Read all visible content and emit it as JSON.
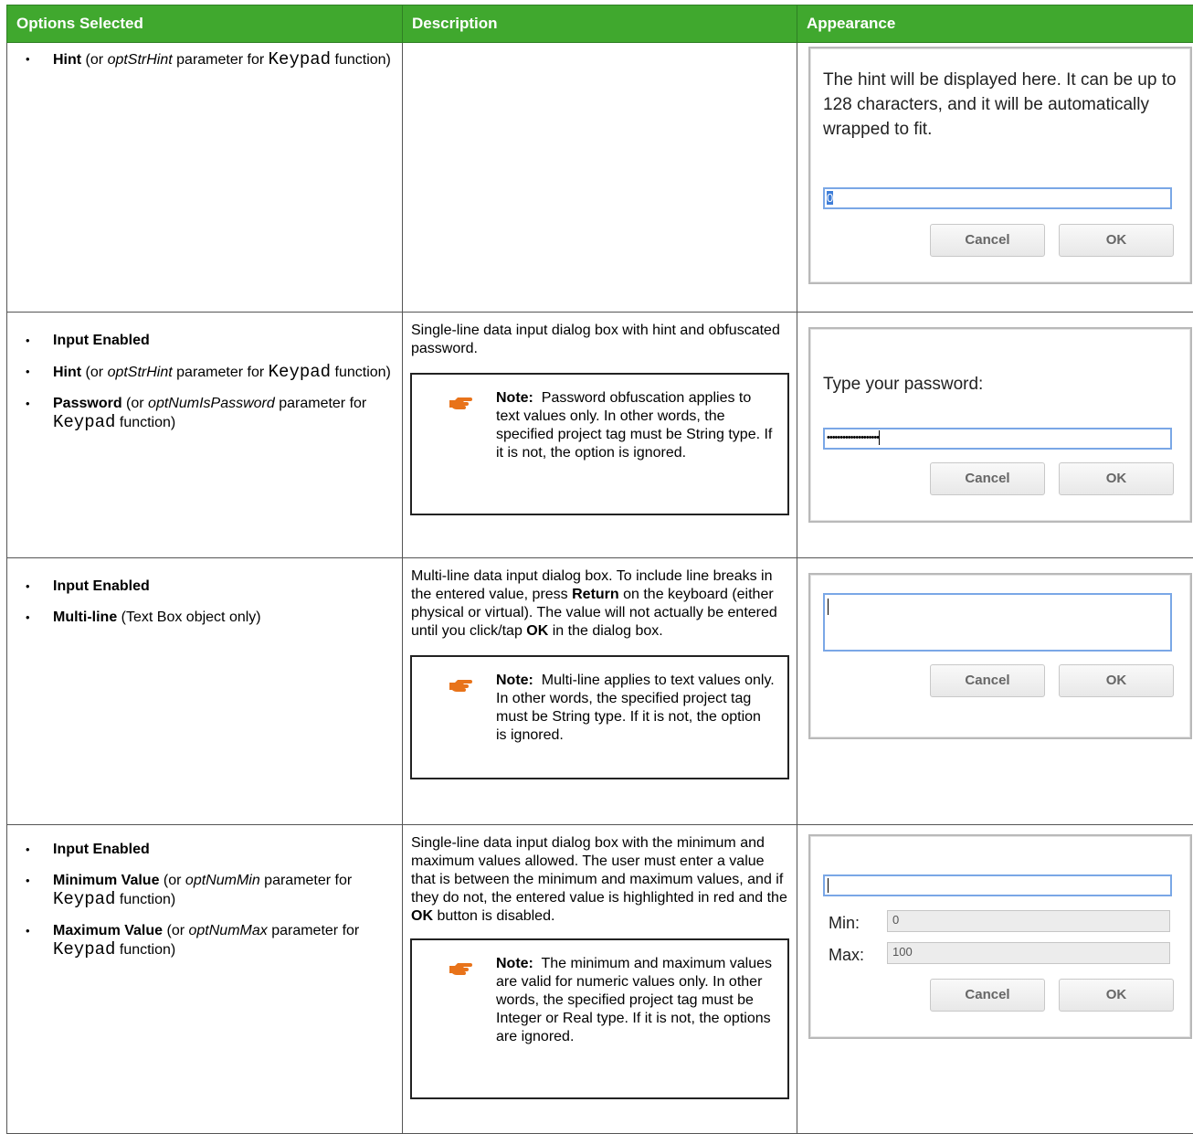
{
  "header": {
    "col_options": "Options Selected",
    "col_description": "Description",
    "col_appearance": "Appearance"
  },
  "rows": [
    {
      "options": [
        {
          "bold": "Hint",
          "pre": " (or ",
          "italic": "optStrHint",
          "mid": " parameter for ",
          "mono": "Keypad",
          "post": " function)"
        }
      ],
      "dialog": {
        "hint": "The hint will be displayed here. It can be up to 128 characters, and it will be automatically wrapped to fit.",
        "input_value": "0",
        "cancel": "Cancel",
        "ok": "OK"
      }
    },
    {
      "options": [
        {
          "bold": "Input Enabled"
        },
        {
          "bold": "Hint",
          "pre": " (or ",
          "italic": "optStrHint",
          "mid": " parameter for ",
          "mono": "Keypad",
          "post": " function)"
        },
        {
          "bold": "Password",
          "pre": " (or ",
          "italic": "optNumIsPassword",
          "mid": " parameter for ",
          "mono": "Keypad",
          "post": " function)"
        }
      ],
      "description": "Single-line data input dialog box with hint and obfuscated password.",
      "note": {
        "label": "Note:",
        "text": "Password obfuscation applies to text values only. In other words, the specified project tag must be String type. If it is not, the option is ignored."
      },
      "dialog": {
        "hint": "Type your password:",
        "input_value": "••••••••••••••••••••",
        "cancel": "Cancel",
        "ok": "OK"
      }
    },
    {
      "options": [
        {
          "bold": "Input Enabled"
        },
        {
          "bold": "Multi-line",
          "pre": " (Text Box object only)"
        }
      ],
      "description_parts": {
        "a": "Multi-line data input dialog box. To include line breaks in the entered value, press ",
        "b": "Return",
        "c": " on the keyboard (either physical or virtual). The value will not actually be entered until you click/tap ",
        "d": "OK",
        "e": " in the dialog box."
      },
      "note": {
        "label": "Note:",
        "text": "Multi-line applies to text values only. In other words, the specified project tag must be String type. If it is not, the option is ignored."
      },
      "dialog": {
        "cancel": "Cancel",
        "ok": "OK"
      }
    },
    {
      "options": [
        {
          "bold": "Input Enabled"
        },
        {
          "bold": "Minimum Value",
          "pre": " (or ",
          "italic": "optNumMin",
          "mid": " parameter for ",
          "mono": "Keypad",
          "post": " function)"
        },
        {
          "bold": "Maximum Value",
          "pre": " (or ",
          "italic": "optNumMax",
          "mid": " parameter for ",
          "mono": "Keypad",
          "post": " function)"
        }
      ],
      "description_parts": {
        "a": "Single-line data input dialog box with the minimum and maximum values allowed. The user must enter a value that is between the minimum and maximum values, and if they do not, the entered value is highlighted in red and the ",
        "b": "OK",
        "c": " button is disabled."
      },
      "note": {
        "label": "Note:",
        "text": "The minimum and maximum values are valid for numeric values only. In other words, the specified project tag must be Integer or Real type. If it is not, the options are ignored."
      },
      "dialog": {
        "min_label": "Min:",
        "min_value": "0",
        "max_label": "Max:",
        "max_value": "100",
        "cancel": "Cancel",
        "ok": "OK"
      }
    }
  ],
  "colors": {
    "header_bg": "#40A82E",
    "note_hand": "#E8731A",
    "input_border": "#7aa7e6"
  }
}
